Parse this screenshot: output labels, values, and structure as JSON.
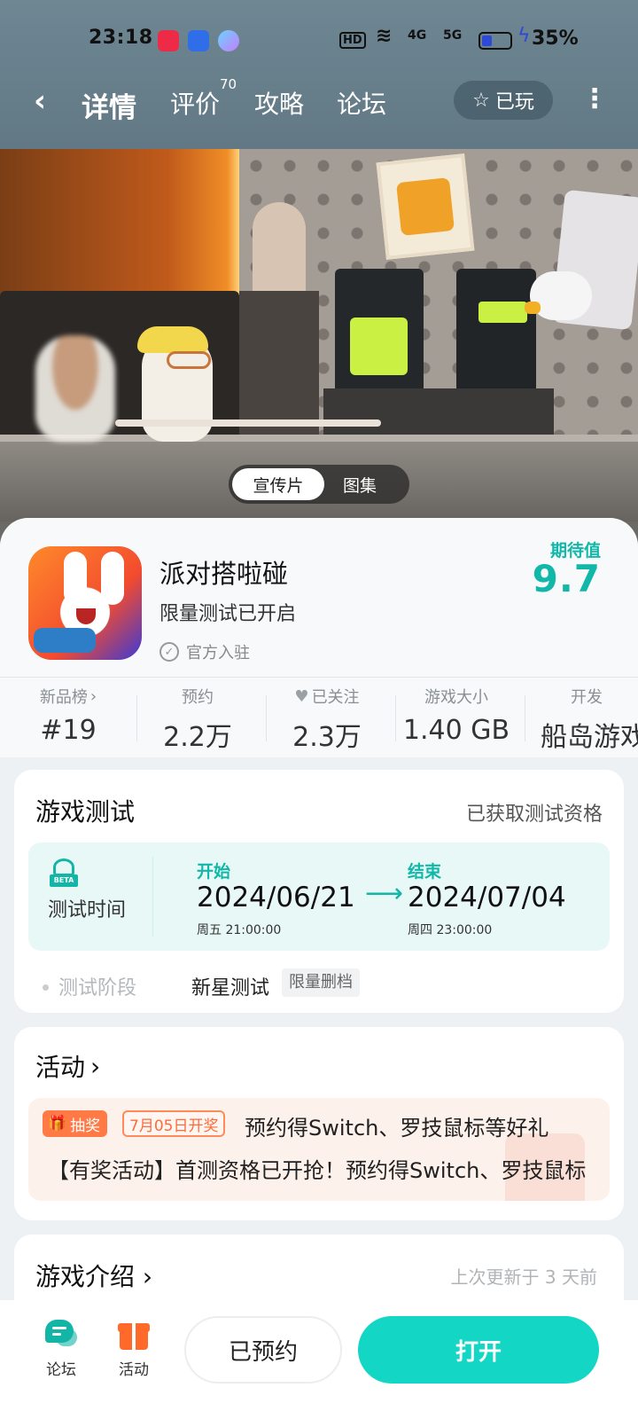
{
  "status_bar": {
    "time": "23:18",
    "hd": "HD",
    "net1": "4G",
    "net2": "5G",
    "battery_pct": "35%",
    "battery_level": 0.35
  },
  "nav": {
    "tabs": [
      {
        "label": "详情",
        "active": true
      },
      {
        "label": "评价",
        "badge": "70"
      },
      {
        "label": "攻略"
      },
      {
        "label": "论坛"
      }
    ],
    "played_label": "已玩"
  },
  "media_toggle": {
    "options": [
      "宣传片",
      "图集"
    ],
    "selected": "宣传片"
  },
  "game": {
    "name": "派对搭啦碰",
    "subtitle": "限量测试已开启",
    "official": "官方入驻",
    "expect_label": "期待值",
    "expect_value": "9.7"
  },
  "stats": [
    {
      "label": "新品榜",
      "value": "#19"
    },
    {
      "label": "预约",
      "value": "2.2万"
    },
    {
      "label": "已关注",
      "value": "2.3万"
    },
    {
      "label": "游戏大小",
      "value": "1.40 GB"
    },
    {
      "label": "开发",
      "value": "船岛游戏"
    }
  ],
  "game_test": {
    "title": "游戏测试",
    "right": "已获取测试资格",
    "beta_tag": "BETA",
    "time_label": "测试时间",
    "start_label": "开始",
    "start_date": "2024/06/21",
    "start_detail": "周五  21:00:00",
    "end_label": "结束",
    "end_date": "2024/07/04",
    "end_detail": "周四  23:00:00",
    "phase_label": "测试阶段",
    "phase_value": "新星测试",
    "phase_tag": "限量删档"
  },
  "activity": {
    "title": "活动",
    "lottery": "抽奖",
    "date_badge": "7月05日开奖",
    "line1": "预约得Switch、罗技鼠标等好礼",
    "line2": "【有奖活动】首测资格已开抢！预约得Switch、罗技鼠标"
  },
  "intro": {
    "title": "游戏介绍",
    "right": "上次更新于 3 天前"
  },
  "bottom": {
    "forum": "论坛",
    "activity": "活动",
    "reserved": "已预约",
    "open": "打开"
  },
  "colors": {
    "accent": "#14d6c5",
    "accent_text": "#11b7a8",
    "orange": "#ff6a2a"
  }
}
